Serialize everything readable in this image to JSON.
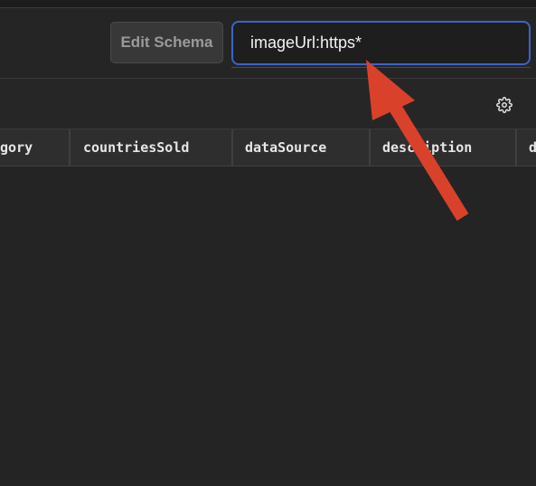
{
  "toolbar": {
    "edit_schema_label": "Edit Schema",
    "search_value": "imageUrl:https*"
  },
  "subbar": {
    "settings_icon": "gear-icon"
  },
  "table": {
    "columns": [
      "gory",
      "countriesSold",
      "dataSource",
      "description",
      "d"
    ]
  },
  "annotation": {
    "arrow_color": "#d9412b"
  },
  "colors": {
    "background": "#242424",
    "search_focus_border": "#3d63c9"
  }
}
